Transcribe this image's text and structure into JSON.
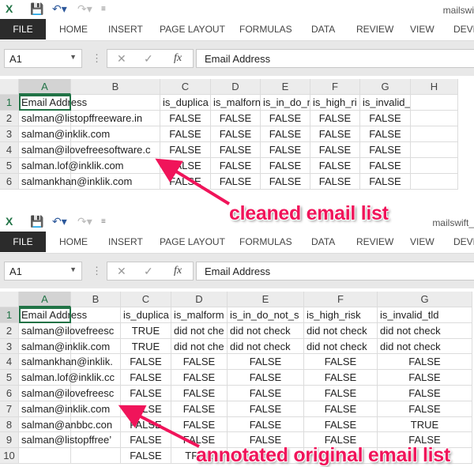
{
  "colors": {
    "accent": "#217346",
    "annotation": "#f0145a",
    "file_tab": "#2b2b2b"
  },
  "top": {
    "filename": "mailswi",
    "tabs": [
      "FILE",
      "HOME",
      "INSERT",
      "PAGE LAYOUT",
      "FORMULAS",
      "DATA",
      "REVIEW",
      "VIEW",
      "DEVE"
    ],
    "name_box": "A1",
    "formula": "Email Address",
    "columns": [
      "A",
      "B",
      "C",
      "D",
      "E",
      "F",
      "G",
      "H"
    ],
    "rows": [
      [
        "Email Address",
        "",
        "is_duplica",
        "is_malforn",
        "is_in_do_n",
        "is_high_ri",
        "is_invalid_tld",
        ""
      ],
      [
        "salman@listopffreeware.in",
        "",
        "FALSE",
        "FALSE",
        "FALSE",
        "FALSE",
        "FALSE",
        ""
      ],
      [
        "salman@inklik.com",
        "",
        "FALSE",
        "FALSE",
        "FALSE",
        "FALSE",
        "FALSE",
        ""
      ],
      [
        "salman@ilovefreesoftware.c",
        "",
        "FALSE",
        "FALSE",
        "FALSE",
        "FALSE",
        "FALSE",
        ""
      ],
      [
        "salman.lof@inklik.com",
        "",
        "FALSE",
        "FALSE",
        "FALSE",
        "FALSE",
        "FALSE",
        ""
      ],
      [
        "salmankhan@inklik.com",
        "",
        "FALSE",
        "FALSE",
        "FALSE",
        "FALSE",
        "FALSE",
        ""
      ]
    ]
  },
  "bottom": {
    "filename": "mailswift_",
    "tabs": [
      "FILE",
      "HOME",
      "INSERT",
      "PAGE LAYOUT",
      "FORMULAS",
      "DATA",
      "REVIEW",
      "VIEW",
      "DEVE"
    ],
    "name_box": "A1",
    "formula": "Email Address",
    "columns": [
      "A",
      "B",
      "C",
      "D",
      "E",
      "F",
      "G"
    ],
    "rows": [
      [
        "Email Address",
        "",
        "is_duplica",
        "is_malform",
        "is_in_do_not_s",
        "is_high_risk",
        "is_invalid_tld"
      ],
      [
        "salman@ilovefreesc",
        "",
        "TRUE",
        "did not che",
        "did not check",
        "did not check",
        "did not check"
      ],
      [
        "salman@inklik.com",
        "",
        "TRUE",
        "did not che",
        "did not check",
        "did not check",
        "did not check"
      ],
      [
        "salmankhan@inklik.",
        "",
        "FALSE",
        "FALSE",
        "FALSE",
        "FALSE",
        "FALSE"
      ],
      [
        "salman.lof@inklik.cc",
        "",
        "FALSE",
        "FALSE",
        "FALSE",
        "FALSE",
        "FALSE"
      ],
      [
        "salman@ilovefreesc",
        "",
        "FALSE",
        "FALSE",
        "FALSE",
        "FALSE",
        "FALSE"
      ],
      [
        "salman@inklik.com",
        "",
        "FALSE",
        "FALSE",
        "FALSE",
        "FALSE",
        "FALSE"
      ],
      [
        "salman@anbbc.con",
        "",
        "FALSE",
        "FALSE",
        "FALSE",
        "FALSE",
        "TRUE"
      ],
      [
        "salman@listopffree’",
        "",
        "FALSE",
        "FALSE",
        "FALSE",
        "FALSE",
        "FALSE"
      ],
      [
        "",
        "",
        "FALSE",
        "TRUE",
        "",
        "",
        ""
      ]
    ]
  },
  "annotations": {
    "top": "cleaned email list",
    "bottom": "annotated original email list"
  }
}
